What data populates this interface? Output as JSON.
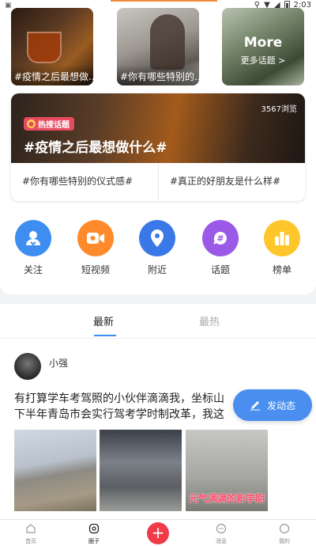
{
  "status_bar": {
    "left_icon": "notification-icon",
    "time": "2:03",
    "accent_color": "#f08a3c"
  },
  "topic_thumbs": [
    {
      "caption": "#疫情之后最想做..."
    },
    {
      "caption": "#你有哪些特别的..."
    },
    {
      "more_title": "More",
      "more_link": "更多话题 >"
    }
  ],
  "hot_topic": {
    "badge": "热搜话题",
    "title": "#疫情之后最想做什么#",
    "views": "3567浏览",
    "sub_topics": [
      "#你有哪些特别的仪式感#",
      "#真正的好朋友是什么样#"
    ],
    "badge_color": "#e84a5f"
  },
  "quick_actions": [
    {
      "label": "关注",
      "icon": "user-icon",
      "color": "#3d8ef0"
    },
    {
      "label": "短视频",
      "icon": "video-icon",
      "color": "#ff8a2b"
    },
    {
      "label": "附近",
      "icon": "location-icon",
      "color": "#3a78e8"
    },
    {
      "label": "话题",
      "icon": "hashtag-icon",
      "color": "#9b59e8"
    },
    {
      "label": "榜单",
      "icon": "chart-icon",
      "color": "#ffc62b"
    }
  ],
  "feed_tabs": {
    "active": "最新",
    "inactive": "最热",
    "accent": "#3d8ef0"
  },
  "post": {
    "username": "小强",
    "text_line1": "有打算学车考驾照的小伙伴滴滴我，坐标山",
    "text_line2": "下半年青岛市会实行驾考学时制改革，我这",
    "image3_caption": "元气满满的新学期"
  },
  "fab_label": "发动态",
  "bottom_nav": {
    "home": "首页",
    "circle": "圈子",
    "publish": "+",
    "messages": "消息",
    "mine": "我的"
  }
}
